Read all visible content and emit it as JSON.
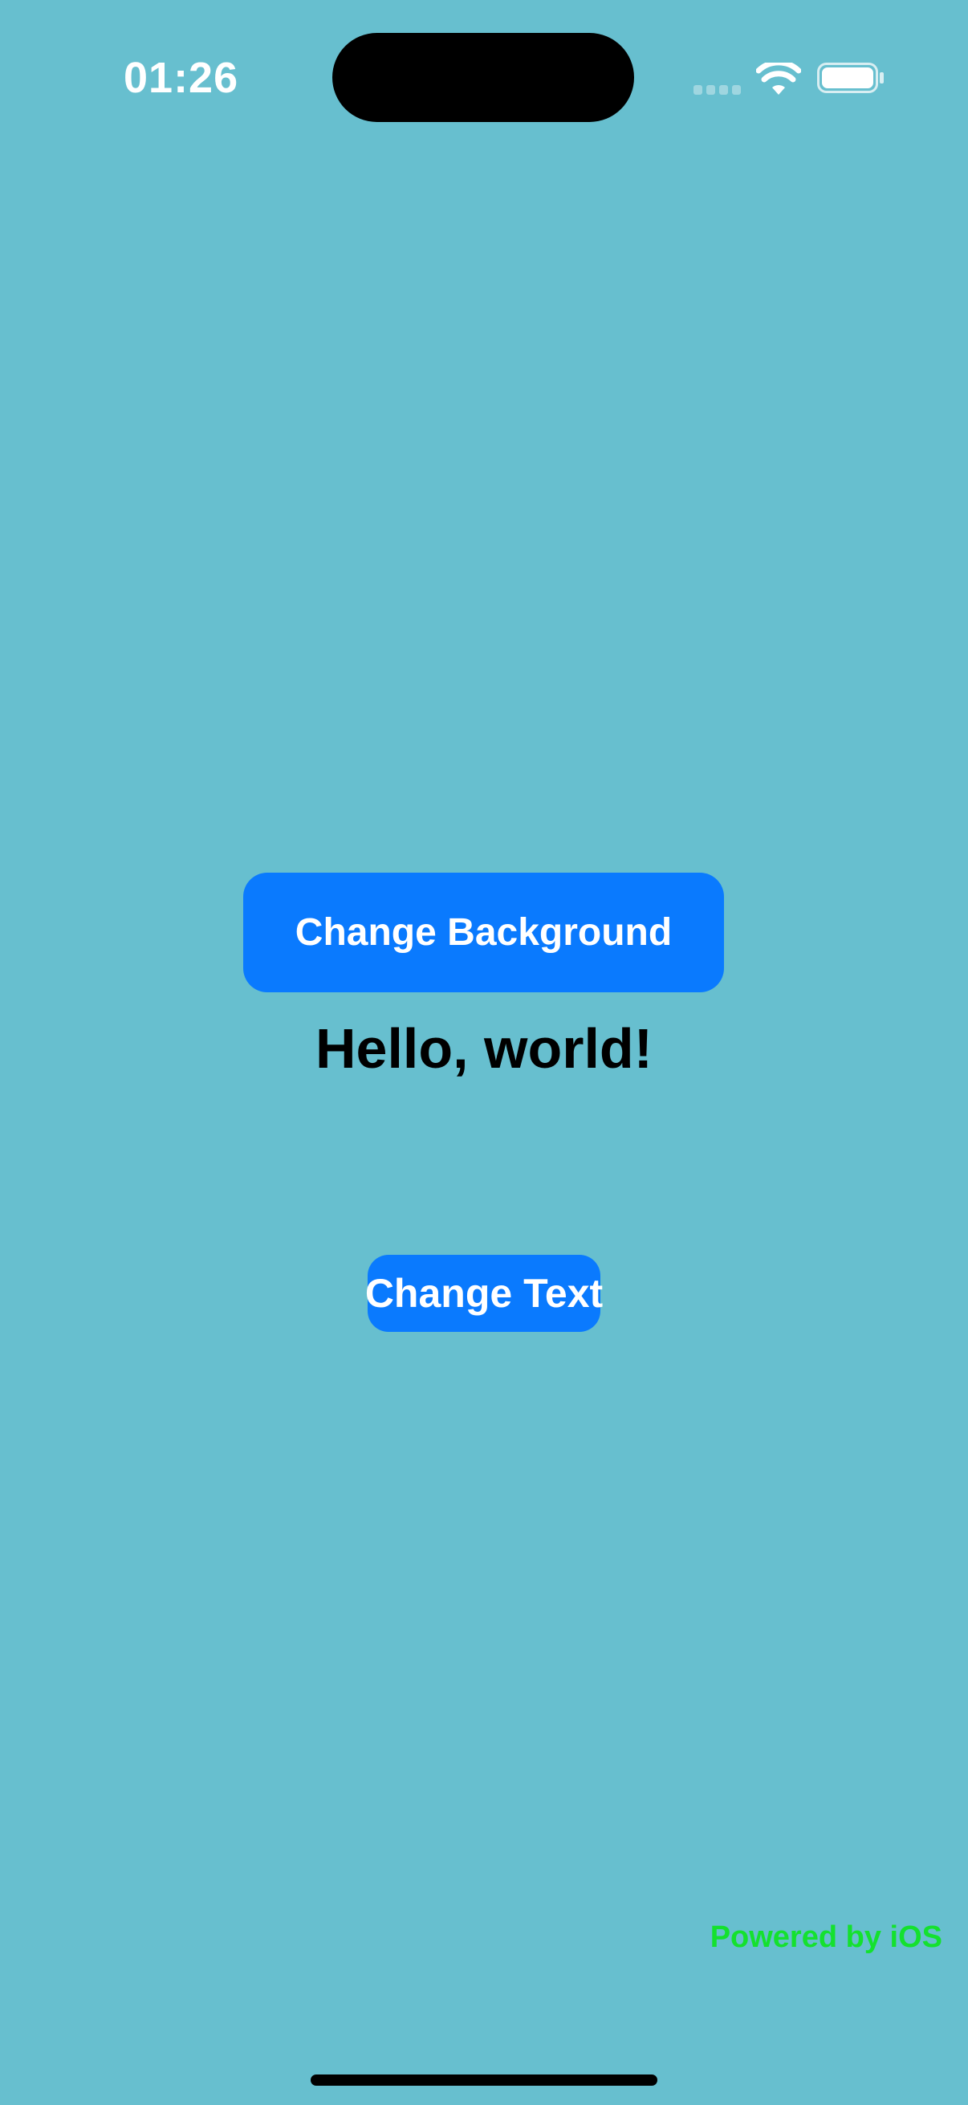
{
  "status_bar": {
    "time": "01:26",
    "icons": [
      "cell-signal-icon",
      "wifi-icon",
      "battery-icon"
    ]
  },
  "main": {
    "change_background_label": "Change Background",
    "greeting": "Hello, world!",
    "change_text_label": "Change Text"
  },
  "footer": {
    "powered_by": "Powered by iOS"
  },
  "colors": {
    "background": "#67BFCF",
    "button": "#0A7AFE",
    "button_text": "#FFFFFF",
    "greeting_text": "#000000",
    "powered_by_text": "#14E12E"
  }
}
